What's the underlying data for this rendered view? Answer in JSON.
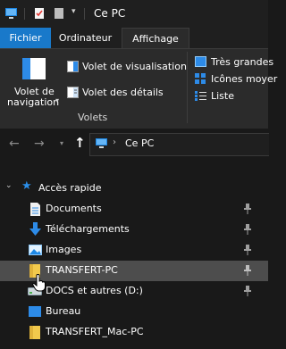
{
  "window": {
    "title": "Ce PC"
  },
  "tabs": {
    "file": "Fichier",
    "computer": "Ordinateur",
    "view": "Affichage"
  },
  "ribbon": {
    "nav_pane": {
      "line1": "Volet de",
      "line2": "navigation"
    },
    "preview_pane": "Volet de visualisation",
    "details_pane": "Volet des détails",
    "group_label": "Volets",
    "layout": {
      "very_large": "Très grandes",
      "medium": "Icônes moyer",
      "list": "Liste"
    }
  },
  "address": {
    "location": "Ce PC"
  },
  "tree": {
    "quick_access": "Accès rapide",
    "items": [
      {
        "label": "Documents",
        "icon": "documents-icon",
        "pinned": true
      },
      {
        "label": "Téléchargements",
        "icon": "downloads-icon",
        "pinned": true
      },
      {
        "label": "Images",
        "icon": "pictures-icon",
        "pinned": true
      },
      {
        "label": "TRANSFERT-PC",
        "icon": "folder-icon",
        "pinned": true,
        "selected": true
      },
      {
        "label": "DOCS et autres (D:)",
        "icon": "drive-icon",
        "pinned": true
      },
      {
        "label": "Bureau",
        "icon": "desktop-icon",
        "pinned": false
      },
      {
        "label": "TRANSFERT_Mac-PC",
        "icon": "folder-icon",
        "pinned": false
      }
    ]
  },
  "colors": {
    "background": "#191919",
    "ribbon": "#2b2b2b",
    "file_tab": "#1979ca",
    "selection": "#4d4d4d",
    "folder": "#f2c94c",
    "star": "#2b8ee8"
  }
}
